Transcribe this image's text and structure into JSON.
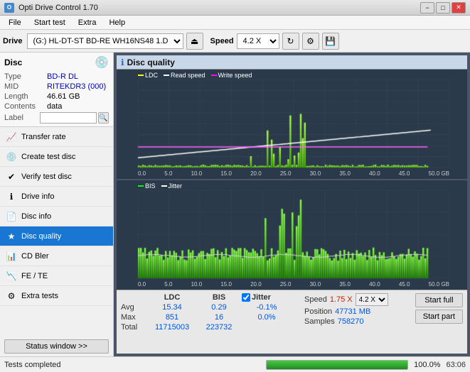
{
  "app": {
    "title": "Opti Drive Control 1.70",
    "icon": "O"
  },
  "titlebar": {
    "minimize": "−",
    "maximize": "□",
    "close": "✕"
  },
  "menu": {
    "items": [
      "File",
      "Start test",
      "Extra",
      "Help"
    ]
  },
  "toolbar": {
    "drive_label": "Drive",
    "drive_value": "(G:) HL-DT-ST BD-RE  WH16NS48 1.D3",
    "speed_label": "Speed",
    "speed_value": "4.2 X"
  },
  "disc": {
    "section_label": "Disc",
    "type_label": "Type",
    "type_value": "BD-R DL",
    "mid_label": "MID",
    "mid_value": "RITEKDR3 (000)",
    "length_label": "Length",
    "length_value": "46.61 GB",
    "contents_label": "Contents",
    "contents_value": "data",
    "label_label": "Label",
    "label_value": ""
  },
  "nav": {
    "items": [
      {
        "id": "transfer-rate",
        "label": "Transfer rate",
        "icon": "📈"
      },
      {
        "id": "create-test-disc",
        "label": "Create test disc",
        "icon": "💿"
      },
      {
        "id": "verify-test-disc",
        "label": "Verify test disc",
        "icon": "✔"
      },
      {
        "id": "drive-info",
        "label": "Drive info",
        "icon": "ℹ"
      },
      {
        "id": "disc-info",
        "label": "Disc info",
        "icon": "📄"
      },
      {
        "id": "disc-quality",
        "label": "Disc quality",
        "icon": "★",
        "active": true
      },
      {
        "id": "cd-bler",
        "label": "CD Bler",
        "icon": "📊"
      },
      {
        "id": "fe-te",
        "label": "FE / TE",
        "icon": "📉"
      },
      {
        "id": "extra-tests",
        "label": "Extra tests",
        "icon": "⚙"
      }
    ],
    "status_btn": "Status window >>"
  },
  "chart": {
    "title": "Disc quality",
    "legend1": {
      "ldc": "LDC",
      "read": "Read speed",
      "write": "Write speed"
    },
    "legend2": {
      "bis": "BIS",
      "jitter": "Jitter"
    },
    "top_y_labels": [
      "900",
      "800",
      "700",
      "600",
      "500",
      "400",
      "300",
      "200",
      "100"
    ],
    "top_y_right": [
      "18X",
      "16X",
      "14X",
      "12X",
      "10X",
      "8X",
      "6X",
      "4X",
      "2X"
    ],
    "bottom_y_labels": [
      "20",
      "15",
      "10",
      "5"
    ],
    "bottom_y_right": [
      "10%",
      "8%",
      "6%",
      "4%",
      "2%"
    ],
    "x_labels": [
      "0.0",
      "5.0",
      "10.0",
      "15.0",
      "20.0",
      "25.0",
      "30.0",
      "35.0",
      "40.0",
      "45.0",
      "50.0 GB"
    ]
  },
  "stats": {
    "headers": {
      "ldc": "LDC",
      "bis": "BIS",
      "jitter_label": "Jitter",
      "speed_label": "Speed",
      "speed_val": "1.75 X",
      "speed_select": "4.2 X"
    },
    "avg": {
      "label": "Avg",
      "ldc": "15.34",
      "bis": "0.29",
      "jitter": "-0.1%"
    },
    "max": {
      "label": "Max",
      "ldc": "851",
      "bis": "16",
      "jitter": "0.0%",
      "position_label": "Position",
      "position_val": "47731 MB"
    },
    "total": {
      "label": "Total",
      "ldc": "11715003",
      "bis": "223732",
      "samples_label": "Samples",
      "samples_val": "758270"
    },
    "start_full_btn": "Start full",
    "start_part_btn": "Start part"
  },
  "statusbar": {
    "text": "Tests completed",
    "progress": 100,
    "progress_text": "100.0%",
    "right_val": "63:06"
  }
}
